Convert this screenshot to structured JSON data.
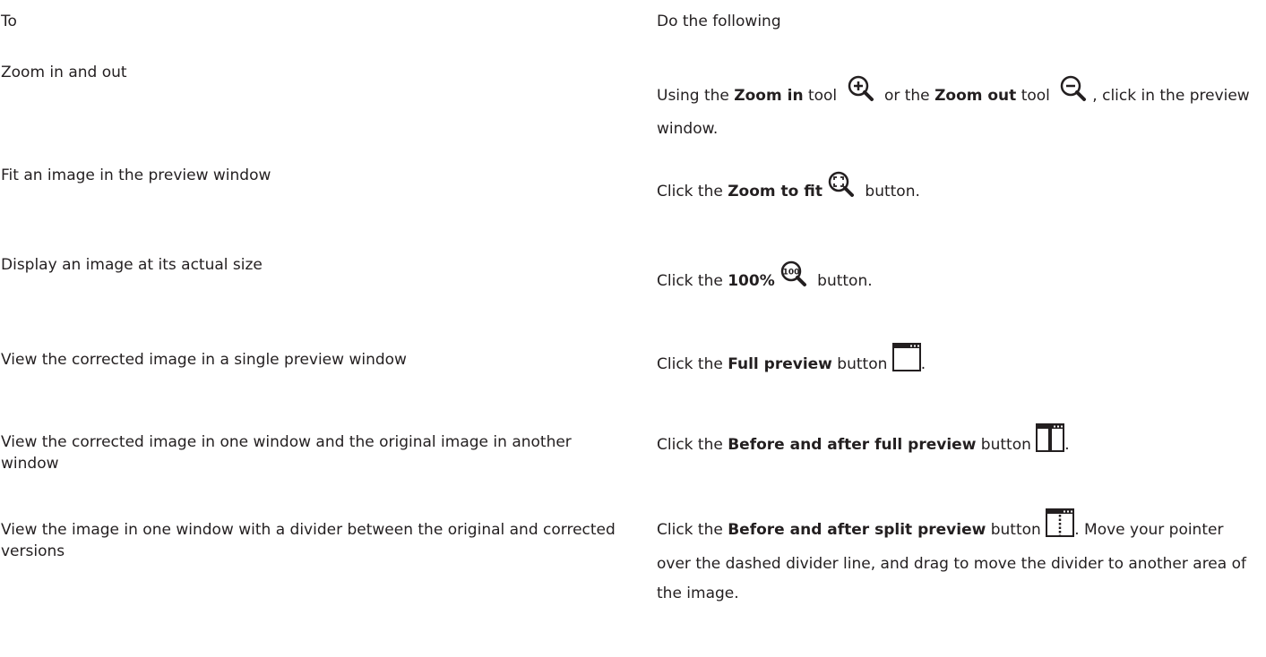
{
  "header": {
    "col_to": "To",
    "col_do": "Do the following"
  },
  "rows": [
    {
      "to": "Zoom in and out",
      "d1": "Using the ",
      "b1": "Zoom in",
      "d2": " tool ",
      "d3": " or the ",
      "b2": "Zoom out",
      "d4": " tool ",
      "d5": ", click in the preview window.",
      "icons": [
        "zoom-in-icon",
        "zoom-out-icon"
      ]
    },
    {
      "to": "Fit an image in the preview window",
      "d1": "Click the ",
      "b1": "Zoom to fit",
      "d2": " button.",
      "icons": [
        "zoom-to-fit-icon"
      ]
    },
    {
      "to": "Display an image at its actual size",
      "d1": "Click the ",
      "b1": "100%",
      "d2": " button.",
      "icons": [
        "zoom-100-icon"
      ],
      "icon_text": "100"
    },
    {
      "to": "View the corrected image in a single preview window",
      "d1": "Click the ",
      "b1": "Full preview",
      "d2": " button ",
      "d3": ".",
      "icons": [
        "full-preview-icon"
      ]
    },
    {
      "to": "View the corrected image in one window and the original image in another window",
      "d1": "Click the ",
      "b1": "Before and after full preview",
      "d2": " button ",
      "d3": ".",
      "icons": [
        "before-after-full-preview-icon"
      ]
    },
    {
      "to": "View the image in one window with a divider between the original and corrected versions",
      "d1": "Click the ",
      "b1": "Before and after split preview",
      "d2": " button ",
      "d3": ". Move your pointer over the dashed divider line, and drag to move the divider to another area of the image.",
      "icons": [
        "before-after-split-preview-icon"
      ]
    }
  ]
}
